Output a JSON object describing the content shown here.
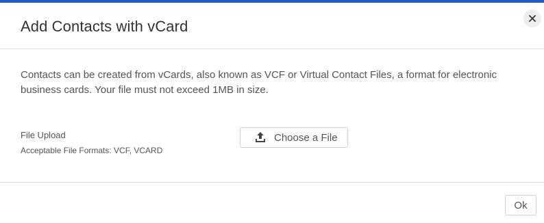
{
  "dialog": {
    "title": "Add Contacts with vCard",
    "close_icon": "close-icon",
    "description": "Contacts can be created from vCards, also known as VCF or Virtual Contact Files, a format for electronic business cards. Your file must not exceed 1MB in size.",
    "upload": {
      "label": "File Upload",
      "hint": "Acceptable File Formats: VCF, VCARD",
      "button_label": "Choose a File",
      "button_icon": "upload-icon"
    },
    "footer": {
      "ok_label": "Ok"
    }
  },
  "colors": {
    "accent": "#1f5fbf",
    "divider": "#e2e2e2",
    "text": "#555555"
  }
}
